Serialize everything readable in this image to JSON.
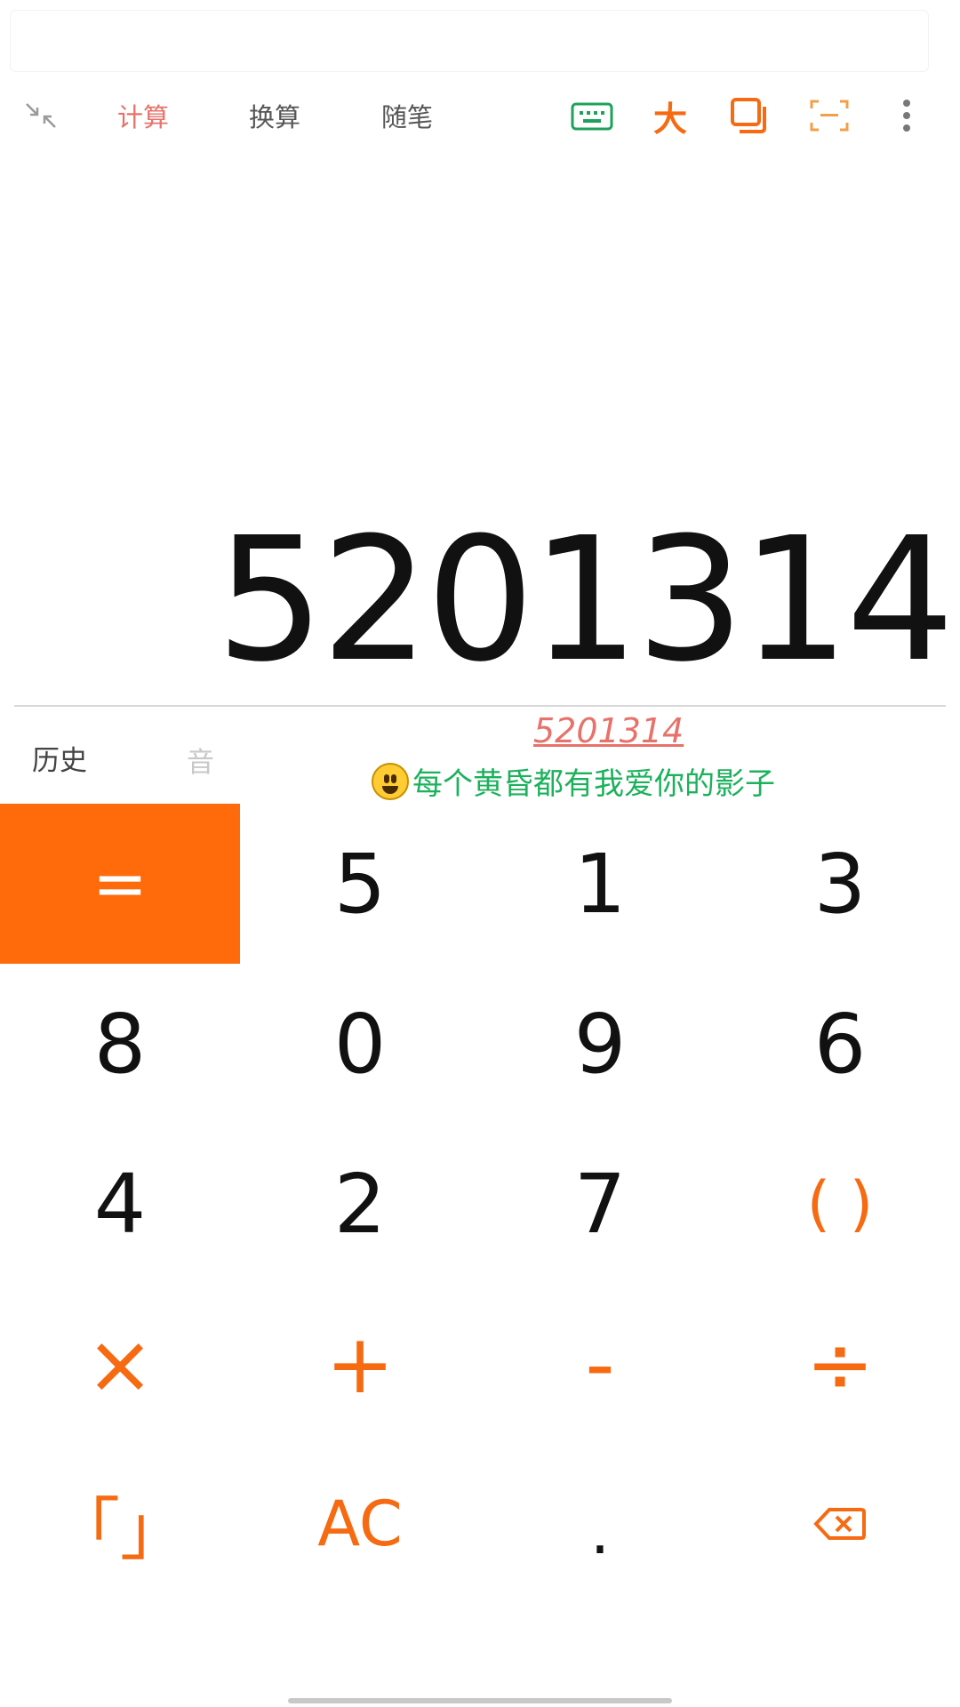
{
  "toolbar": {
    "tabs": [
      {
        "label": "计算",
        "active": true
      },
      {
        "label": "换算",
        "active": false
      },
      {
        "label": "随笔",
        "active": false
      }
    ],
    "icons": [
      "collapse-icon",
      "keyboard-icon",
      "large-text-icon",
      "window-icon",
      "scan-icon",
      "more-icon"
    ],
    "large_text_glyph": "大"
  },
  "display": {
    "value": "5201314"
  },
  "sub_row": {
    "history_label": "历史",
    "sound_label": "音",
    "result_preview": "5201314",
    "message": "每个黄昏都有我爱你的影子"
  },
  "keypad": {
    "rows": [
      [
        "=",
        "5",
        "1",
        "3"
      ],
      [
        "8",
        "0",
        "9",
        "6"
      ],
      [
        "4",
        "2",
        "7",
        "( )"
      ],
      [
        "×",
        "+",
        "-",
        "÷"
      ],
      [
        "「」",
        "AC",
        ".",
        "backspace"
      ]
    ]
  },
  "colors": {
    "accent": "#ff6a0a",
    "active_tab": "#e7726a",
    "message": "#1cb15c",
    "keyboard_icon": "#1ea15a"
  }
}
